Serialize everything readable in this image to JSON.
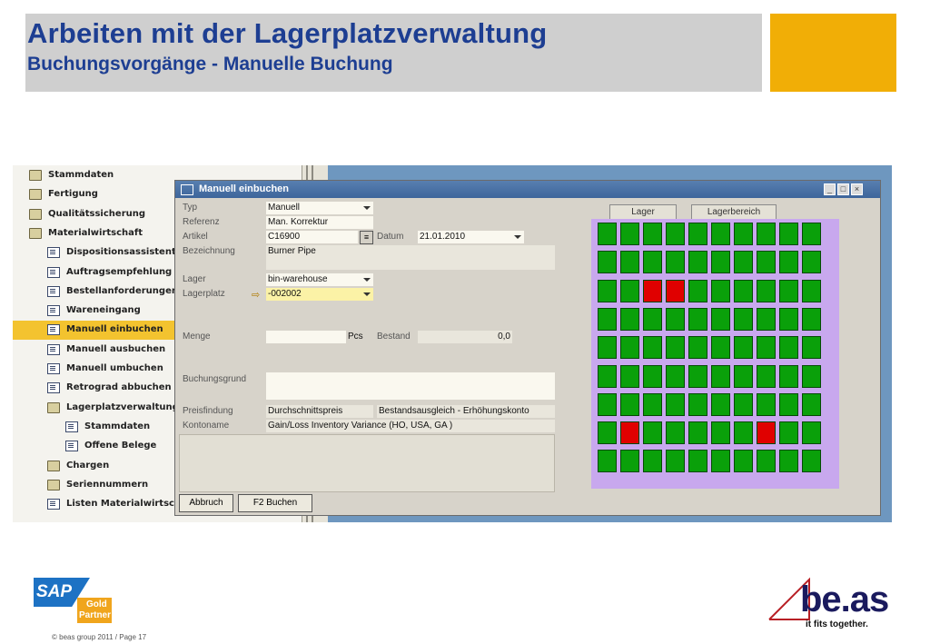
{
  "header": {
    "title": "Arbeiten mit der Lagerplatzverwaltung",
    "subtitle": "Buchungsvorgänge - Manuelle Buchung"
  },
  "nav": {
    "items": [
      {
        "label": "Stammdaten",
        "icon": "folder-icon",
        "level": 0
      },
      {
        "label": "Fertigung",
        "icon": "folder-icon",
        "level": 0
      },
      {
        "label": "Qualitätssicherung",
        "icon": "folder-icon",
        "level": 0
      },
      {
        "label": "Materialwirtschaft",
        "icon": "folder-open-icon",
        "level": 0
      },
      {
        "label": "Dispositionsassistent",
        "icon": "document-icon",
        "level": 1
      },
      {
        "label": "Auftragsempfehlung",
        "icon": "document-icon",
        "level": 1
      },
      {
        "label": "Bestellanforderungen",
        "icon": "document-icon",
        "level": 1
      },
      {
        "label": "Wareneingang",
        "icon": "document-icon",
        "level": 1
      },
      {
        "label": "Manuell einbuchen",
        "icon": "document-icon",
        "level": 1,
        "selected": true
      },
      {
        "label": "Manuell ausbuchen",
        "icon": "document-icon",
        "level": 1
      },
      {
        "label": "Manuell umbuchen",
        "icon": "document-icon",
        "level": 1
      },
      {
        "label": "Retrograd abbuchen",
        "icon": "document-icon",
        "level": 1
      },
      {
        "label": "Lagerplatzverwaltung",
        "icon": "folder-open-icon",
        "level": 1
      },
      {
        "label": "Stammdaten",
        "icon": "document-icon",
        "level": 2
      },
      {
        "label": "Offene Belege",
        "icon": "document-icon",
        "level": 2
      },
      {
        "label": "Chargen",
        "icon": "folder-icon",
        "level": 1
      },
      {
        "label": "Seriennummern",
        "icon": "folder-icon",
        "level": 1
      },
      {
        "label": "Listen Materialwirtschaft",
        "icon": "document-icon",
        "level": 1
      }
    ]
  },
  "window": {
    "title": "Manuell einbuchen",
    "controls": [
      "_",
      "□",
      "×"
    ],
    "form": {
      "typ_label": "Typ",
      "typ_value": "Manuell",
      "referenz_label": "Referenz",
      "referenz_value": "Man. Korrektur",
      "artikel_label": "Artikel",
      "artikel_value": "C16900",
      "datum_label": "Datum",
      "datum_value": "21.01.2010",
      "bezeichnung_label": "Bezeichnung",
      "bezeichnung_value": "Burner Pipe",
      "lager_label": "Lager",
      "lager_value": "bin-warehouse",
      "lagerplatz_label": "Lagerplatz",
      "lagerplatz_value": "-002002",
      "menge_label": "Menge",
      "menge_value": "",
      "menge_unit": "Pcs",
      "bestand_label": "Bestand",
      "bestand_value": "0,0",
      "buchungsgrund_label": "Buchungsgrund",
      "buchungsgrund_value": "",
      "preisfindung_label": "Preisfindung",
      "preisfindung_value": "Durchschnittspreis",
      "preisfindung_extra": "Bestandsausgleich - Erhöhungskonto",
      "kontoname_label": "Kontoname",
      "kontoname_value": "Gain/Loss Inventory Variance (HO, USA, GA )"
    },
    "buttons": {
      "cancel": "Abbruch",
      "book": "F2  Buchen"
    },
    "tabs": [
      "Lager",
      "Lagerbereich"
    ],
    "bin_grid": {
      "columns": 10,
      "rows": 9,
      "colors": {
        "free": "#0aa00a",
        "occupied": "#e00000"
      },
      "occupied_cells": [
        [
          2,
          2
        ],
        [
          2,
          3
        ],
        [
          7,
          1
        ],
        [
          7,
          7
        ]
      ]
    }
  },
  "footer": {
    "sap_logo": "SAP",
    "sap_badge_1": "Gold",
    "sap_badge_2": "Partner",
    "copyright": "© beas group 2011 / Page 17",
    "beas_logo": "be.as",
    "beas_tagline": "it fits together."
  }
}
